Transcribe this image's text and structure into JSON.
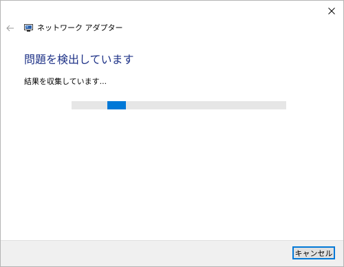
{
  "window": {
    "title": "ネットワーク アダプター",
    "close_icon": "close-icon",
    "back_icon": "back-arrow-icon",
    "app_icon": "network-adapter-icon"
  },
  "main": {
    "heading": "問題を検出しています",
    "status": "結果を収集しています..."
  },
  "progress": {
    "type": "indeterminate",
    "chunk_start_fraction": 0.167,
    "chunk_width_fraction": 0.087
  },
  "footer": {
    "cancel_label": "キャンセル"
  },
  "colors": {
    "heading": "#1e3287",
    "progress_fill": "#0078d7",
    "progress_track": "#e6e6e6",
    "footer_bg": "#f0f0f0"
  }
}
